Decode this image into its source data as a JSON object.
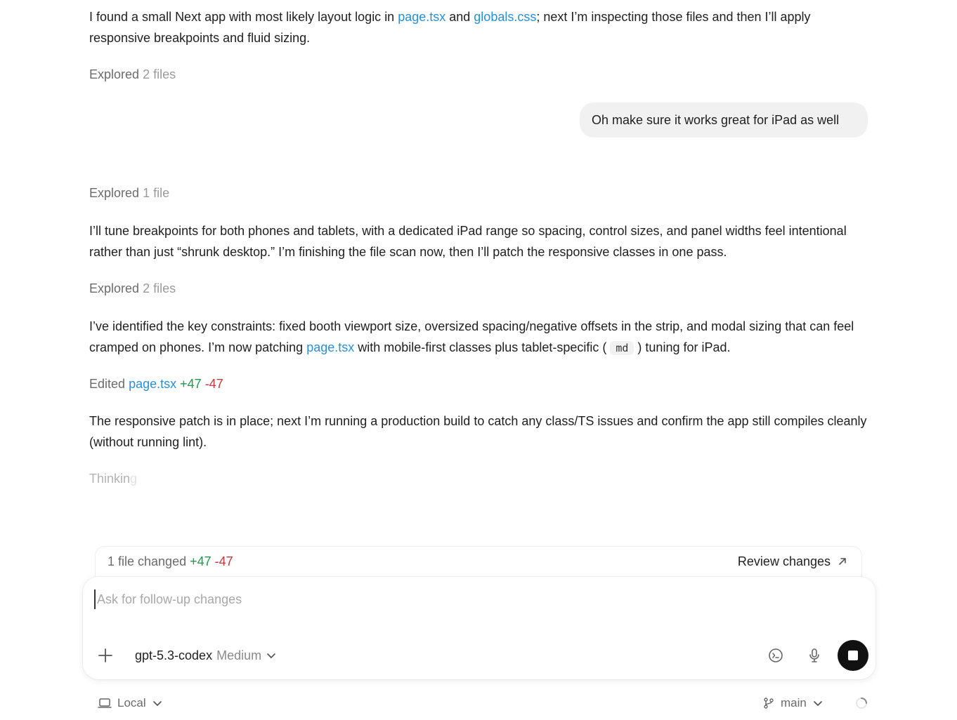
{
  "messages": {
    "m1": {
      "part1": "I found a small Next app with most likely layout logic in ",
      "link1": "page.tsx",
      "part2": " and ",
      "link2": "globals.css",
      "part3": "; next I’m inspecting those files and then I’ll apply responsive breakpoints and fluid sizing."
    },
    "explored1": {
      "verb": "Explored",
      "count": "2 files"
    },
    "user": "Oh make sure it works great for iPad as well",
    "explored2": {
      "verb": "Explored",
      "count": "1 file"
    },
    "m2": "I’ll tune breakpoints for both phones and tablets, with a dedicated iPad range so spacing, control sizes, and panel widths feel intentional rather than just “shrunk desktop.” I’m finishing the file scan now, then I’ll patch the responsive classes in one pass.",
    "explored3": {
      "verb": "Explored",
      "count": "2 files"
    },
    "m3": {
      "part1": "I’ve identified the key constraints: fixed booth viewport size, oversized spacing/negative offsets in the strip, and modal sizing that can feel cramped on phones. I’m now patching ",
      "link": "page.tsx",
      "part2": " with mobile-first classes plus tablet-specific ( ",
      "code": "md",
      "part3": " ) tuning for iPad."
    },
    "edited": {
      "verb": "Edited",
      "file": "page.tsx",
      "added": "+47",
      "removed": "-47"
    },
    "m4": "The responsive patch is in place; next I’m running a production build to catch any class/TS issues and confirm the app still compiles cleanly (without running lint).",
    "thinking": {
      "shown": "Thinkin",
      "fading": "g"
    }
  },
  "changes": {
    "summary": "1 file changed",
    "added": "+47",
    "removed": "-47",
    "review_label": "Review changes",
    "review_icon": "arrow-up-right-icon"
  },
  "composer": {
    "placeholder": "Ask for follow-up changes",
    "value": "",
    "model": "gpt-5.3-codex",
    "effort": "Medium"
  },
  "footer": {
    "env": "Local",
    "branch": "main"
  },
  "colors": {
    "link": "#2a8fd6",
    "added": "#1e9a4a",
    "removed": "#c0393b",
    "stop_button": "#111111"
  }
}
